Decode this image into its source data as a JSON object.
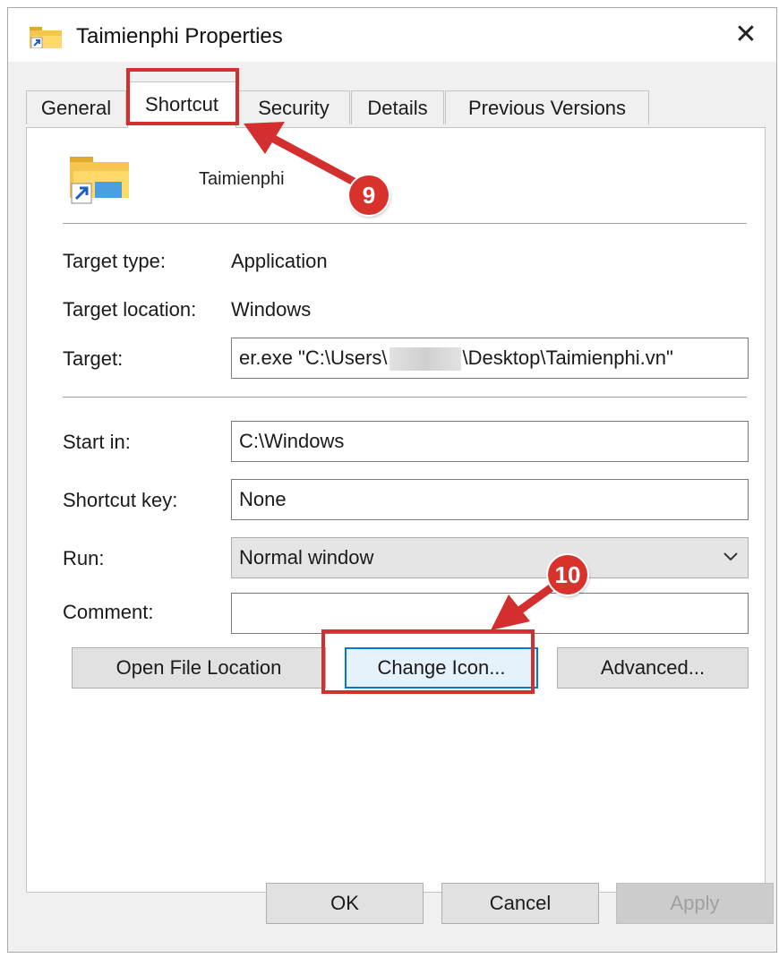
{
  "window": {
    "title": "Taimienphi Properties",
    "close_glyph": "✕"
  },
  "tabs": [
    {
      "label": "General",
      "active": false
    },
    {
      "label": "Shortcut",
      "active": true
    },
    {
      "label": "Security",
      "active": false
    },
    {
      "label": "Details",
      "active": false
    },
    {
      "label": "Previous Versions",
      "active": false
    }
  ],
  "shortcut": {
    "name": "Taimienphi",
    "target_type_label": "Target type:",
    "target_type_value": "Application",
    "target_location_label": "Target location:",
    "target_location_value": "Windows",
    "target_label": "Target:",
    "target_value_start": "er.exe \"C:\\Users\\",
    "target_value_end": "\\Desktop\\Taimienphi.vn\"",
    "start_in_label": "Start in:",
    "start_in_value": "C:\\Windows",
    "shortcut_key_label": "Shortcut key:",
    "shortcut_key_value": "None",
    "run_label": "Run:",
    "run_value": "Normal window",
    "comment_label": "Comment:",
    "comment_value": "",
    "open_file_location": "Open File Location",
    "change_icon": "Change Icon...",
    "advanced": "Advanced..."
  },
  "footer": {
    "ok": "OK",
    "cancel": "Cancel",
    "apply": "Apply"
  },
  "annotations": {
    "step1": "9",
    "step2": "10",
    "highlight_color": "#d32f2f"
  },
  "icons": {
    "title": "folder-shortcut-icon",
    "app": "folder-shortcut-icon",
    "close": "close-icon",
    "dropdown": "chevron-down-icon"
  }
}
